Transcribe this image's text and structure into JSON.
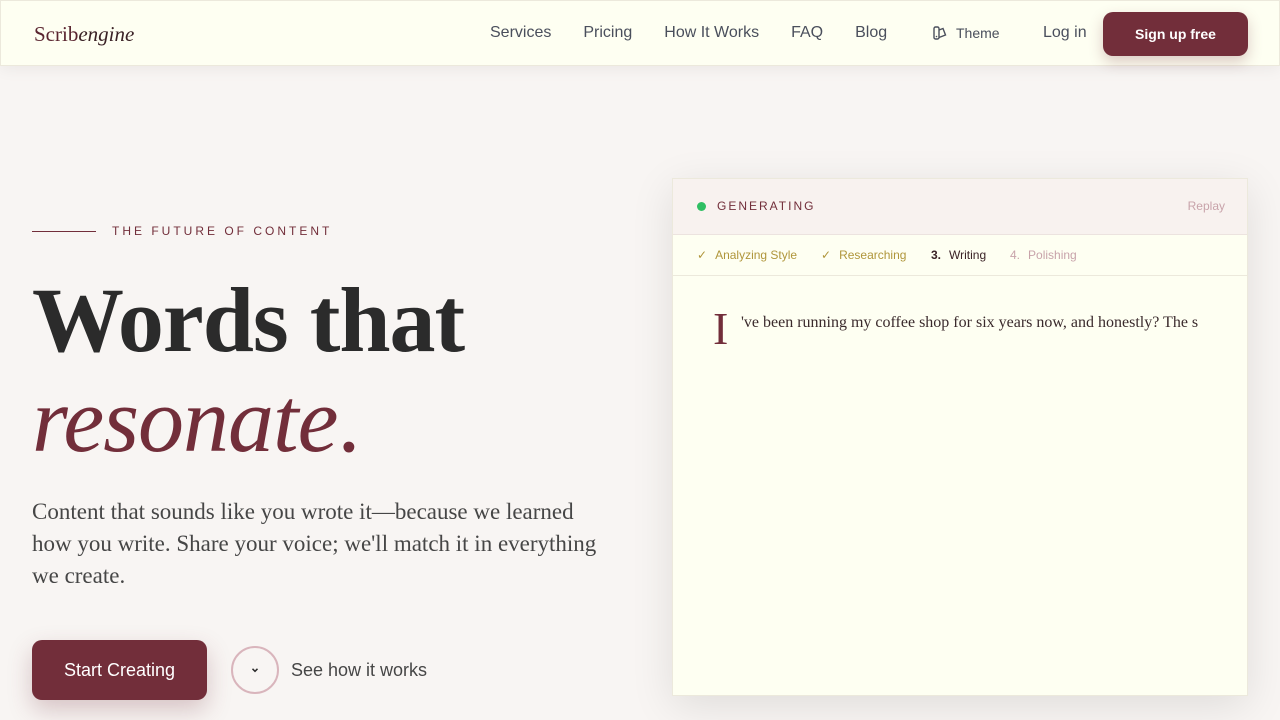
{
  "header": {
    "logo_plain": "Scrib",
    "logo_italic": "engine",
    "nav": [
      "Services",
      "Pricing",
      "How It Works",
      "FAQ",
      "Blog"
    ],
    "theme_label": "Theme",
    "login_label": "Log in",
    "signup_label": "Sign up free"
  },
  "hero": {
    "eyebrow": "THE FUTURE OF CONTENT",
    "headline_line1": "Words that",
    "headline_line2": "resonate",
    "headline_period": ".",
    "subcopy": "Content that sounds like you wrote it—because we learned how you write. Share your voice; we'll match it in everything we create.",
    "cta_label": "Start Creating",
    "secondary_label": "See how it works"
  },
  "card": {
    "status": "GENERATING",
    "replay_label": "Replay",
    "steps": [
      {
        "marker": "✓",
        "label": "Analyzing Style",
        "state": "done"
      },
      {
        "marker": "✓",
        "label": "Researching",
        "state": "done"
      },
      {
        "marker": "3.",
        "label": "Writing",
        "state": "active"
      },
      {
        "marker": "4.",
        "label": "Polishing",
        "state": "pending"
      }
    ],
    "dropcap": "I",
    "generated_text": "'ve been running my coffee shop for six years now, and honestly? The s"
  },
  "colors": {
    "brand": "#722e3a",
    "status_green": "#2fbf63",
    "done_gold": "#b0963b"
  },
  "icons": {
    "theme": "palette-icon",
    "secondary": "chevron-down-icon"
  }
}
